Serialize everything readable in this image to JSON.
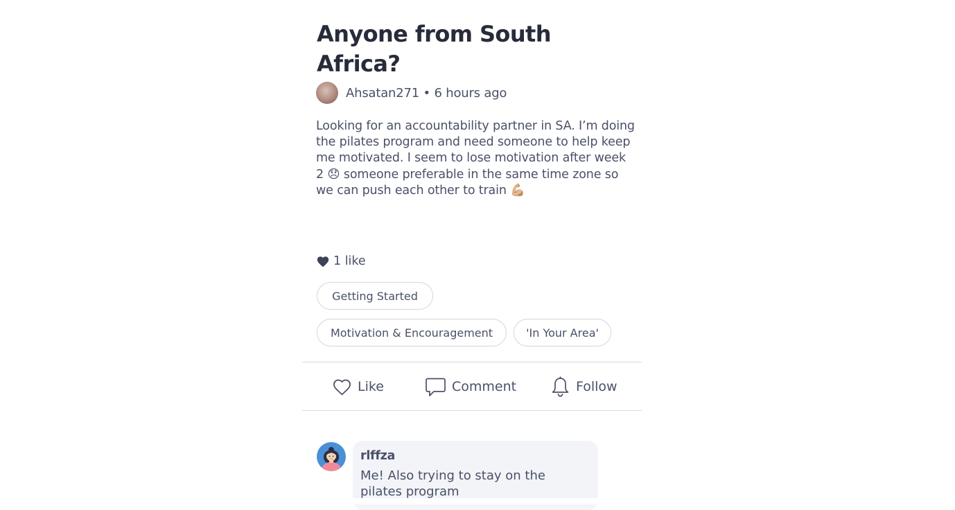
{
  "post": {
    "title": "Anyone from South Africa?",
    "author": "Ahsatan271",
    "timestamp": "6 hours ago",
    "meta_separator": "•",
    "body": "Looking for an accountability partner in SA. I’m doing the pilates program and need someone to help keep me motivated. I seem to lose motivation after week 2 😞 someone preferable in the same time zone so we can push each other to train 💪🏼",
    "likes_label": "1 like",
    "tags": [
      "Getting Started",
      "Motivation & Encouragement",
      "'In Your Area'"
    ]
  },
  "actions": {
    "like_label": "Like",
    "comment_label": "Comment",
    "follow_label": "Follow"
  },
  "comments": [
    {
      "username": "rlffza",
      "text": "Me! Also trying to stay on the pilates program"
    }
  ],
  "icons": {
    "avatar": "user-photo-avatar",
    "likes": "heart-filled-icon",
    "like": "heart-outline-icon",
    "comment": "speech-bubble-icon",
    "follow": "bell-icon",
    "comment_avatar": "woman-avatar-icon"
  },
  "colors": {
    "title": "#272b3a",
    "text": "#4a5068",
    "chip_border": "#d3d6de",
    "divider": "#d6d9e0",
    "comment_bg": "#f2f4f8",
    "comment_avatar_bg": "#4a90d6"
  }
}
